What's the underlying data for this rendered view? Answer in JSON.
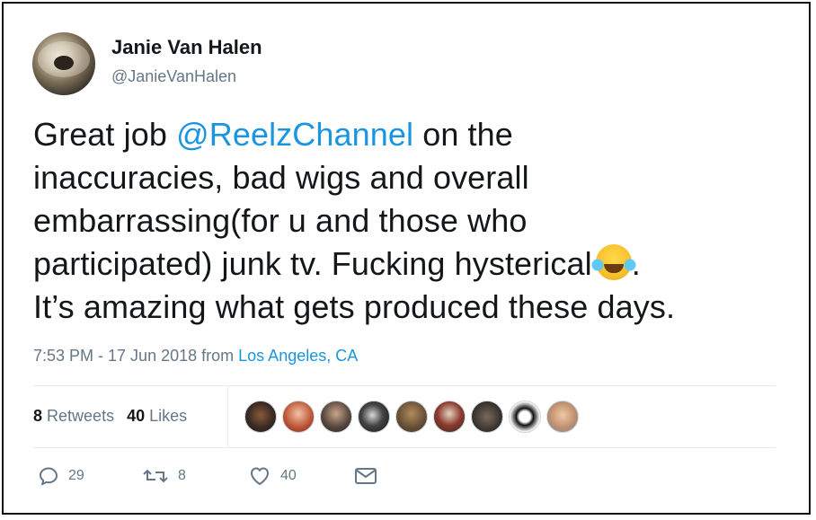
{
  "tweet": {
    "author_name": "Janie Van Halen",
    "author_handle": "@JanieVanHalen",
    "text_lines": {
      "l1_pre": "Great job ",
      "l1_mention": "@ReelzChannel",
      "l1_post": " on the",
      "l2": "inaccuracies, bad wigs and overall",
      "l3": "embarrassing(for u and those who",
      "l4_pre": "participated) junk tv. Fucking hysterical",
      "l4_post": ".",
      "l5": "It’s amazing what gets produced these days."
    },
    "emoji": "face-with-tears-of-joy",
    "time": "7:53 PM - 17 Jun 2018",
    "from_word": "from",
    "location": "Los Angeles, CA"
  },
  "stats": {
    "retweets_count": "8",
    "retweets_label": "Retweets",
    "likes_count": "40",
    "likes_label": "Likes"
  },
  "likers": [
    {
      "name": "liker-avatar-1"
    },
    {
      "name": "liker-avatar-2"
    },
    {
      "name": "liker-avatar-3"
    },
    {
      "name": "liker-avatar-4"
    },
    {
      "name": "liker-avatar-5"
    },
    {
      "name": "liker-avatar-6"
    },
    {
      "name": "liker-avatar-7"
    },
    {
      "name": "liker-avatar-8"
    },
    {
      "name": "liker-avatar-9"
    }
  ],
  "actions": {
    "reply_count": "29",
    "retweet_count": "8",
    "like_count": "40"
  },
  "colors": {
    "link": "#1b95e0",
    "muted": "#657786",
    "text": "#14171a",
    "divider": "#e6ecf0"
  }
}
